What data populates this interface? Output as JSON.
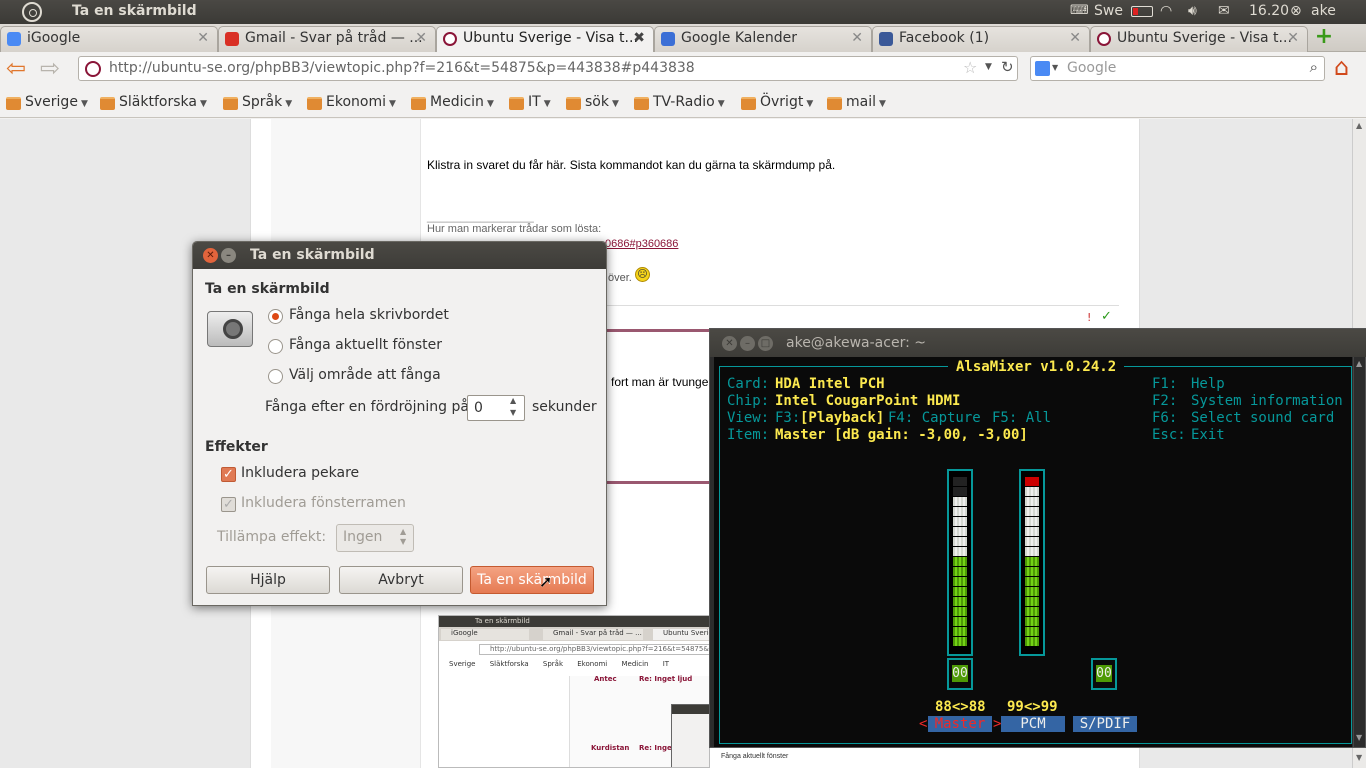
{
  "panel": {
    "window_title": "Ta en skärmbild",
    "keyboard_layout": "Swe",
    "clock": "16.20",
    "user": "ake"
  },
  "tabs": [
    {
      "label": "iGoogle",
      "favicon_color": "#4a8af4"
    },
    {
      "label": "Gmail - Svar på tråd — ...",
      "favicon_color": "#d93025"
    },
    {
      "label": "Ubuntu Sverige - Visa t...",
      "favicon_color": "#8a1538"
    },
    {
      "label": "Google Kalender",
      "favicon_color": "#3b6fd6"
    },
    {
      "label": "Facebook (1)",
      "favicon_color": "#3b5998"
    },
    {
      "label": "Ubuntu Sverige - Visa t...",
      "favicon_color": "#8a1538"
    }
  ],
  "nav": {
    "url": "http://ubuntu-se.org/phpBB3/viewtopic.php?f=216&t=54875&p=443838#p443838",
    "search_placeholder": "Google"
  },
  "bookmarks": [
    "Sverige",
    "Släktforska",
    "Språk",
    "Ekonomi",
    "Medicin",
    "IT",
    "sök",
    "TV-Radio",
    "Övrigt",
    "mail"
  ],
  "post": {
    "text": "Klistra in svaret du får här. Sista kommandot kan du gärna ta skärmdump på.",
    "signature_separator": "________________",
    "signature_text": "Hur man markerar trådar som lösta:",
    "signature_link_fragment": "0686#p360686",
    "partial_text_1": "över.",
    "partial_text_2": "fort man är tvunge"
  },
  "dialog": {
    "title": "Ta en skärmbild",
    "heading": "Ta en skärmbild",
    "options": [
      {
        "label": "Fånga hela skrivbordet",
        "selected": true
      },
      {
        "label": "Fånga aktuellt fönster",
        "selected": false
      },
      {
        "label": "Välj område att fånga",
        "selected": false
      }
    ],
    "delay_label": "Fånga efter en fördröjning på",
    "delay_value": "0",
    "delay_unit": "sekunder",
    "effects_heading": "Effekter",
    "include_pointer": "Inkludera pekare",
    "include_border": "Inkludera fönsterramen",
    "apply_effect_label": "Tillämpa effekt:",
    "apply_effect_value": "Ingen",
    "help_button": "Hjälp",
    "cancel_button": "Avbryt",
    "take_button": "Ta en skärmbild"
  },
  "terminal": {
    "title": "ake@akewa-acer: ~",
    "app_title": "AlsaMixer v1.0.24.2",
    "card_label": "Card:",
    "card_value": "HDA Intel PCH",
    "chip_label": "Chip:",
    "chip_value": "Intel CougarPoint HDMI",
    "view_label": "View:",
    "view_f3": "F3:",
    "view_playback": "[Playback]",
    "view_f4": "F4: Capture",
    "view_f5": "F5: All",
    "item_label": "Item:",
    "item_value": "Master [dB gain: -3,00, -3,00]",
    "help_lines": [
      {
        "key": "F1:",
        "text": "Help"
      },
      {
        "key": "F2:",
        "text": "System information"
      },
      {
        "key": "F6:",
        "text": "Select sound card"
      },
      {
        "key": "Esc:",
        "text": "Exit"
      }
    ],
    "channels": [
      {
        "name": "Master",
        "value_text": "88<>88",
        "mute": "00",
        "level": 0.88,
        "selected": true
      },
      {
        "name": "PCM",
        "value_text": "99<>99",
        "mute": "",
        "level": 0.99,
        "selected": false
      },
      {
        "name": "S/PDIF",
        "value_text": "",
        "mute": "00",
        "level": 0,
        "selected": false
      }
    ]
  },
  "thumbnail": {
    "title": "Ta en skärmbild",
    "tabs": [
      "iGoogle",
      "Gmail - Svar på tråd — ...",
      "Ubuntu Sverige"
    ],
    "url": "http://ubuntu-se.org/phpBB3/viewtopic.php?f=216&t=54875&p=4",
    "bookmarks": [
      "Sverige",
      "Släktforska",
      "Språk",
      "Ekonomi",
      "Medicin",
      "IT"
    ],
    "user_1": "Antec",
    "subject_1": "Re: Inget ljud",
    "user_2": "Kurdistan",
    "subject_2": "Re: Inget",
    "option_text": "Fånga aktuellt fönster"
  }
}
